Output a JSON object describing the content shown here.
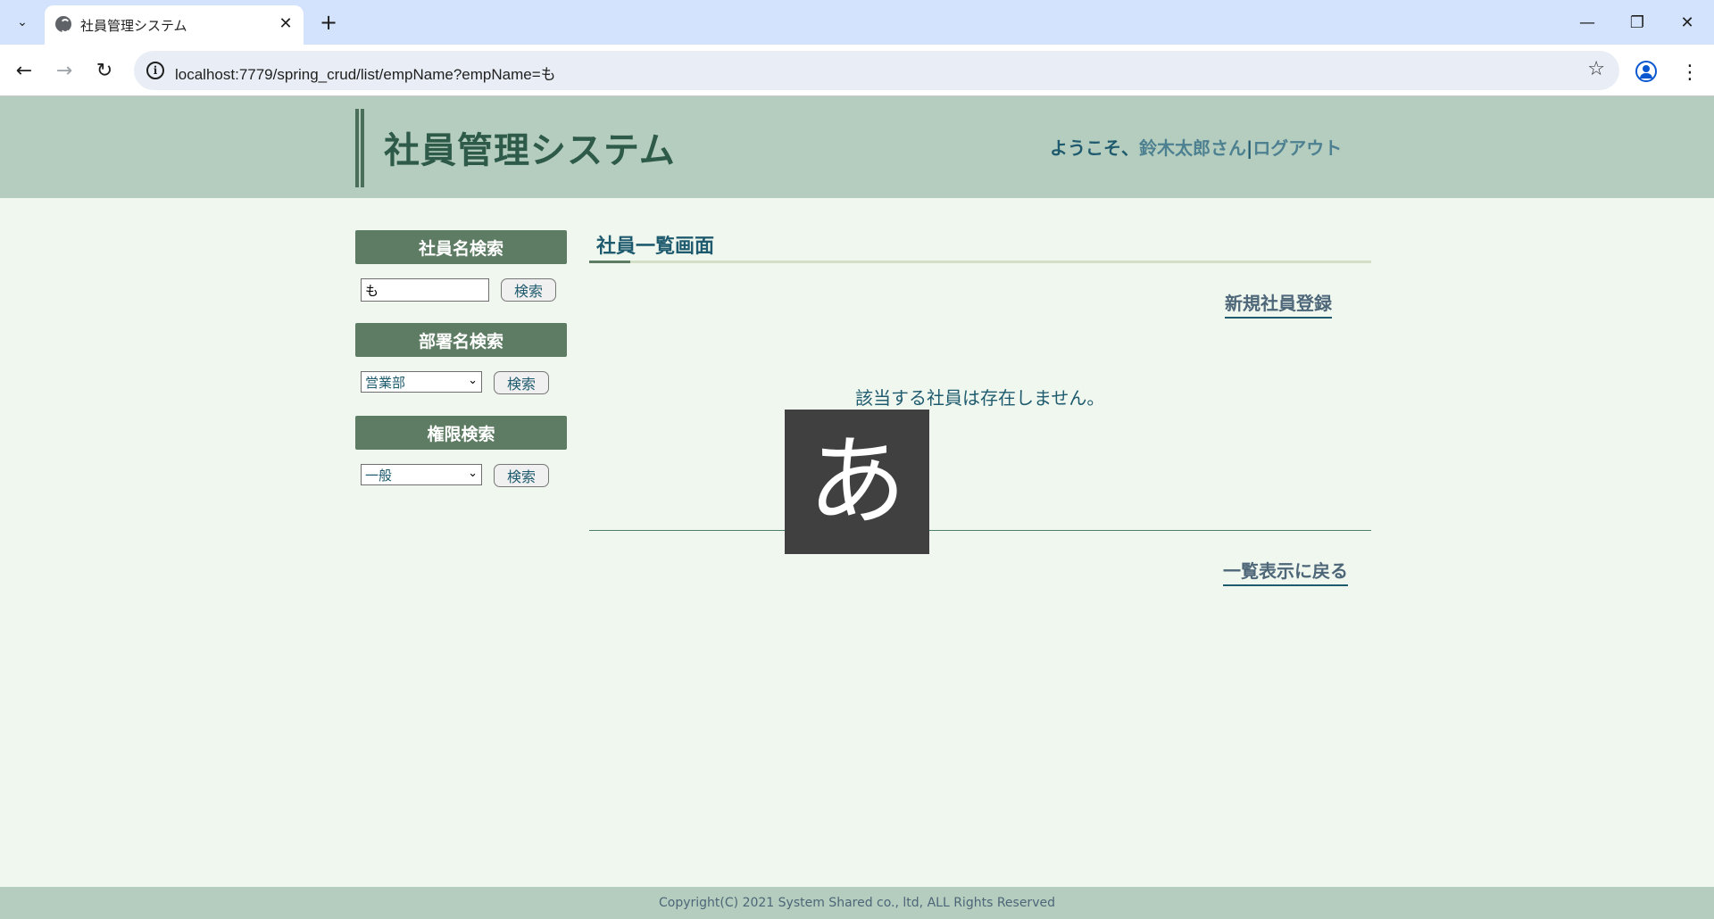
{
  "browser": {
    "tab_title": "社員管理システム",
    "url": "localhost:7779/spring_crud/list/empName?empName=も"
  },
  "header": {
    "title": "社員管理システム",
    "welcome_prefix": "ようこそ、",
    "user_name": "鈴木太郎さん",
    "separator": "|",
    "logout": "ログアウト"
  },
  "sidebar": {
    "emp_search": {
      "heading": "社員名検索",
      "value": "も",
      "button": "検索"
    },
    "dept_search": {
      "heading": "部署名検索",
      "selected": "営業部",
      "button": "検索"
    },
    "role_search": {
      "heading": "権限検索",
      "selected": "一般",
      "button": "検索"
    }
  },
  "main": {
    "title": "社員一覧画面",
    "new_employee_link": "新規社員登録",
    "empty_message": "該当する社員は存在しません。",
    "back_link": "一覧表示に戻る"
  },
  "ime_indicator": "あ",
  "footer": {
    "copyright": "Copyright(C) 2021 System Shared co., ltd, ALL Rights Reserved"
  },
  "icons": {
    "tab_menu": "chevron-down-icon",
    "favicon": "globe-icon",
    "close": "close-icon",
    "new_tab": "plus-icon",
    "back": "arrow-left-icon",
    "forward": "arrow-right-icon",
    "reload": "reload-icon",
    "site_info": "info-icon",
    "bookmark": "star-icon",
    "profile": "profile-icon",
    "menu": "kebab-icon"
  },
  "colors": {
    "header_bg": "#b5cdbe",
    "page_bg": "#f0f7ef",
    "sidebar_head": "#5e7c63",
    "title_text": "#2e5a4a",
    "link_text": "#1f5b6e"
  }
}
